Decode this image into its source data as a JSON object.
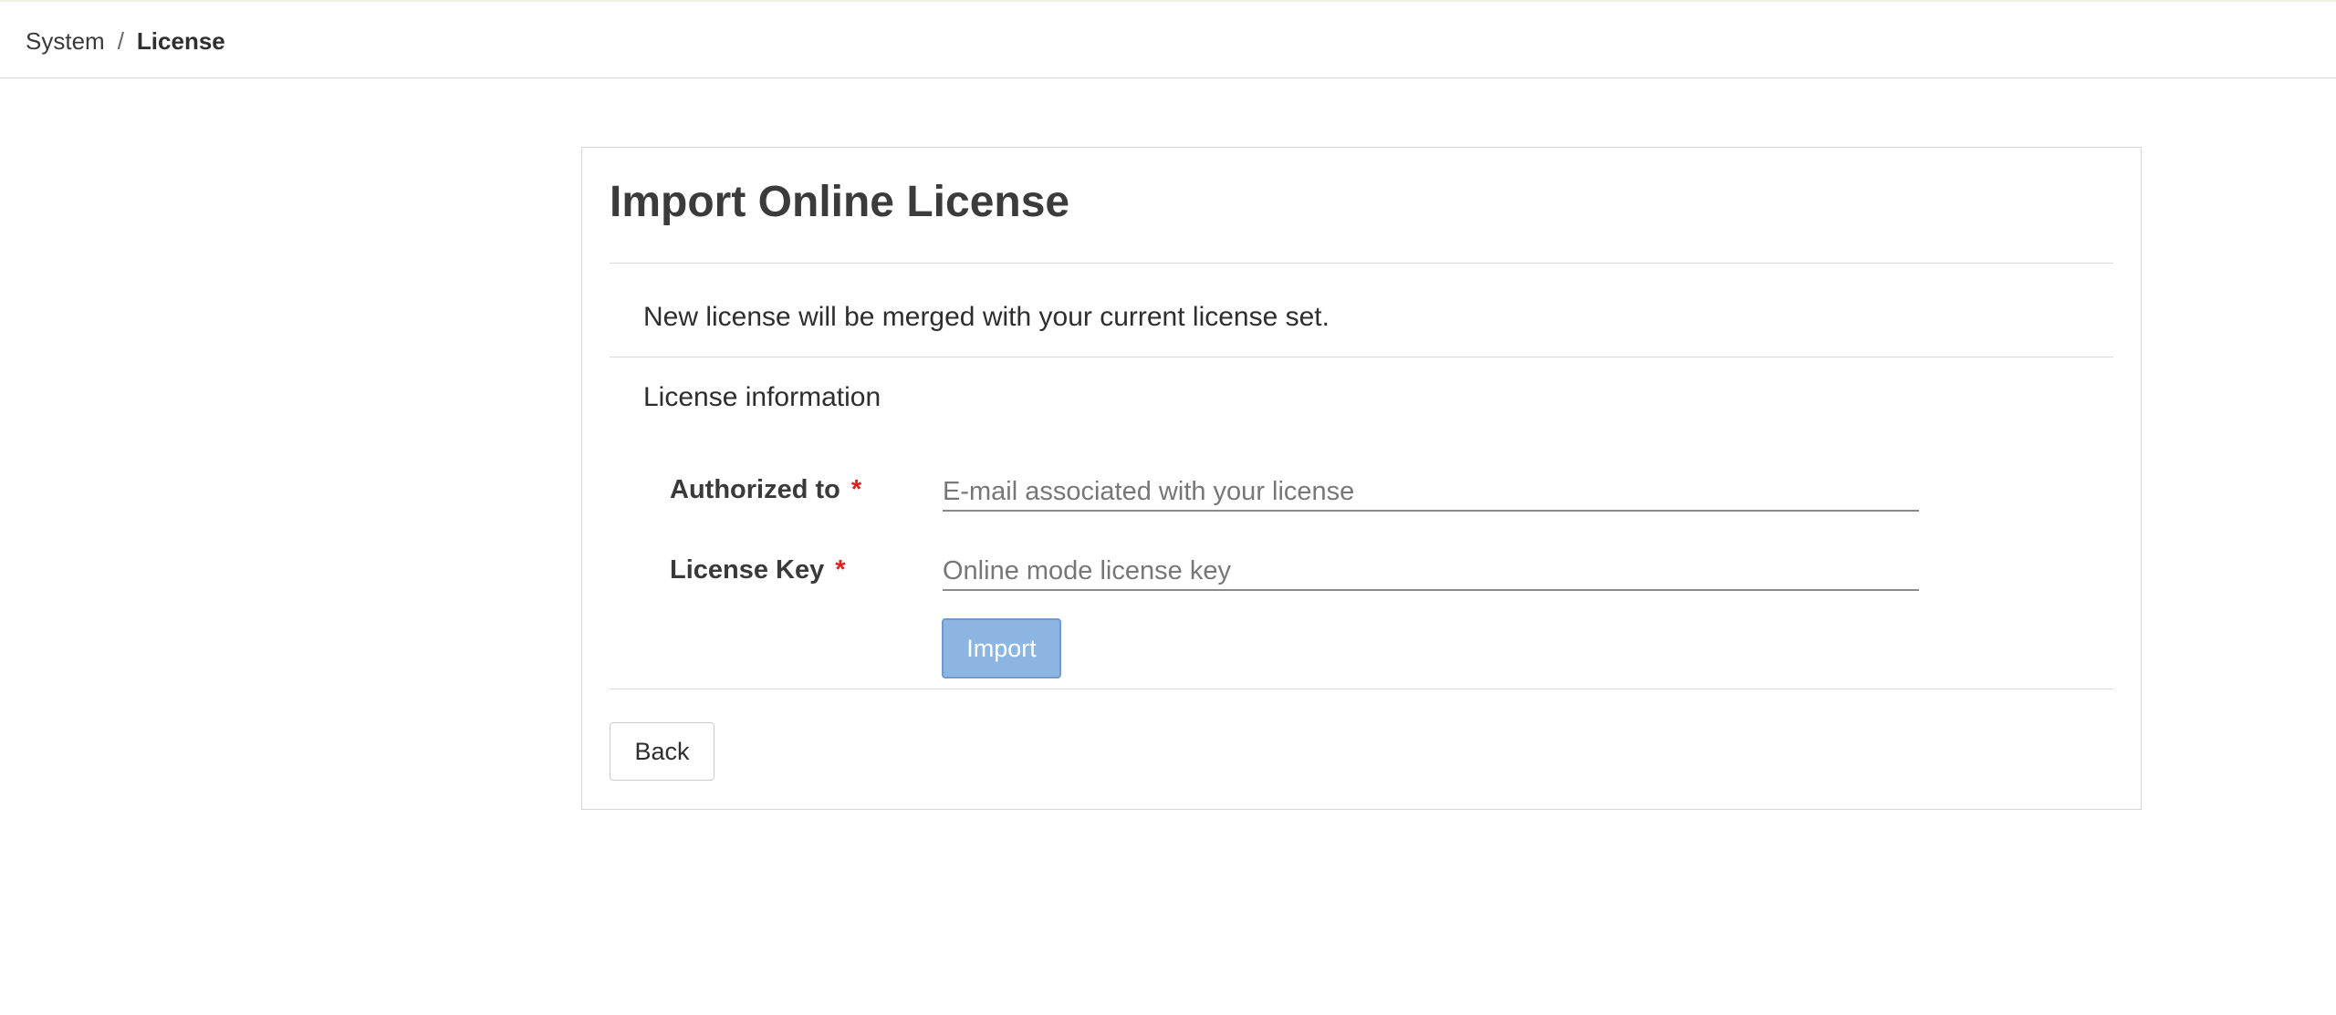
{
  "breadcrumb": {
    "parent": "System",
    "separator": "/",
    "current": "License"
  },
  "panel": {
    "title": "Import Online License",
    "intro": "New license will be merged with your current license set.",
    "section_label": "License information"
  },
  "form": {
    "authorized_to": {
      "label": "Authorized to",
      "required_mark": "*",
      "value": "",
      "placeholder": "E-mail associated with your license"
    },
    "license_key": {
      "label": "License Key",
      "required_mark": "*",
      "value": "",
      "placeholder": "Online mode license key"
    },
    "import_label": "Import"
  },
  "footer": {
    "back_label": "Back"
  },
  "colors": {
    "import_button": "#8db5e2",
    "required": "#e01f1f"
  }
}
